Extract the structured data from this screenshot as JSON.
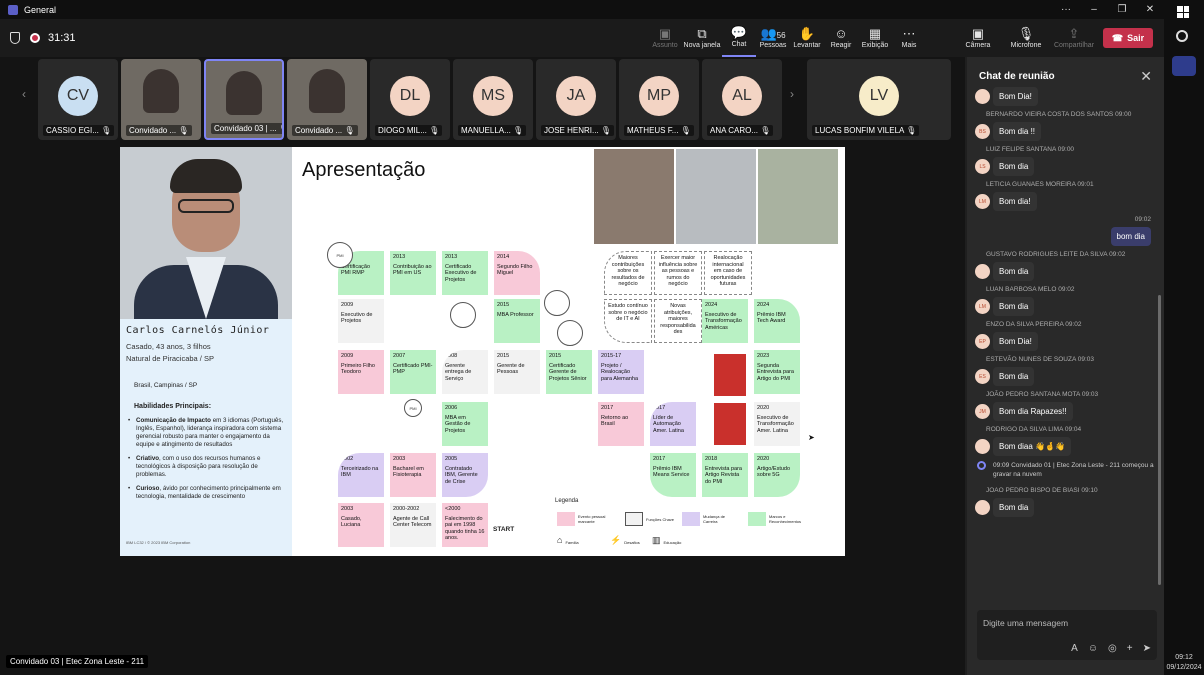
{
  "window": {
    "title": "General"
  },
  "meeting": {
    "timer": "31:31"
  },
  "toolbar": {
    "items": [
      {
        "label": "Assunto",
        "icon": "camera-off"
      },
      {
        "label": "Nova janela",
        "icon": "pop-out"
      },
      {
        "label": "Chat",
        "icon": "chat"
      },
      {
        "label": "Pessoas",
        "icon": "people",
        "count": "56"
      },
      {
        "label": "Levantar",
        "icon": "hand"
      },
      {
        "label": "Reagir",
        "icon": "smile"
      },
      {
        "label": "Exibição",
        "icon": "grid"
      },
      {
        "label": "Mais",
        "icon": "more"
      },
      {
        "label": "Câmera",
        "icon": "camera-off"
      },
      {
        "label": "Microfone",
        "icon": "mic-off"
      },
      {
        "label": "Compartilhar",
        "icon": "share"
      }
    ],
    "leave_label": "Sair"
  },
  "participants": [
    {
      "initials": "CV",
      "name": "CASSIO EGI...",
      "color": "#c9dff2",
      "video": false
    },
    {
      "initials": "",
      "name": "Convidado ...",
      "video": true
    },
    {
      "initials": "",
      "name": "Convidado 03 | ...",
      "video": true
    },
    {
      "initials": "",
      "name": "Convidado ...",
      "video": true
    },
    {
      "initials": "DL",
      "name": "DIOGO MIL...",
      "color": "#f3d4c4",
      "video": false
    },
    {
      "initials": "MS",
      "name": "MANUELLA...",
      "color": "#f3d4c4",
      "video": false
    },
    {
      "initials": "JA",
      "name": "JOSE HENRI...",
      "color": "#f3d4c4",
      "video": false
    },
    {
      "initials": "MP",
      "name": "MATHEUS F...",
      "color": "#f3d4c4",
      "video": false
    },
    {
      "initials": "AL",
      "name": "ANA CARO...",
      "color": "#f3d4c4",
      "video": false
    },
    {
      "initials": "LV",
      "name": "LUCAS BONFIM VILELA",
      "color": "#f7ecc9",
      "video": false
    }
  ],
  "slide": {
    "title": "Apresentação",
    "name": "Carlos Carnelós Júnior",
    "age_line": "Casado, 43 anos, 3 filhos",
    "origin_line": "Natural de Piracicaba / SP",
    "location": "Brasil, Campinas / SP",
    "skills_title": "Habilidades Principais:",
    "skills": [
      {
        "bold": "Comunicação de Impacto",
        "text": " em 3 idiomas (Português, Inglês, Espanhol), liderança inspiradora com sistema gerencial robusto para manter o engajamento da equipe e atingimento de resultados"
      },
      {
        "bold": "Criativo",
        "text": ", com o uso dos recursos humanos e tecnológicos à disposição para resolução de problemas."
      },
      {
        "bold": "Curioso",
        "text": ", ávido por conhecimento principalmente em tecnologia, mentalidade de crescimento"
      }
    ],
    "copyright": "IBM LC32 / © 2023 IBM Corporation",
    "timeline": [
      {
        "year": "2011",
        "text": "Certificação PMI RMP"
      },
      {
        "year": "2013",
        "text": "Contribuição ao PMI em US"
      },
      {
        "year": "2013",
        "text": "Certificado Executivo de Projetos"
      },
      {
        "year": "2014",
        "text": "Segundo Filho Miguel"
      },
      {
        "year": "2009",
        "text": "Executivo de Projetos"
      },
      {
        "year": "2015",
        "text": "MBA Professor"
      },
      {
        "year": "2009",
        "text": "Primeiro Filho Teodoro"
      },
      {
        "year": "2007",
        "text": "Certificado PMI-PMP"
      },
      {
        "year": "2008",
        "text": "Gerente entrega de Serviço"
      },
      {
        "year": "2015",
        "text": "Gerente de Pessoas"
      },
      {
        "year": "2015",
        "text": "Certificado Gerente de Projetos Sênior"
      },
      {
        "year": "2015-17",
        "text": "Projeto / Realocação para Alemanha"
      },
      {
        "year": "2006",
        "text": "MBA em Gestão de Projetos"
      },
      {
        "year": "2017",
        "text": "Retorno ao Brasil"
      },
      {
        "year": "2017",
        "text": "Líder de Automação Amer. Latina"
      },
      {
        "year": "2002",
        "text": "Terceirizado na IBM"
      },
      {
        "year": "2003",
        "text": "Bacharel em Fisioterapia"
      },
      {
        "year": "2005",
        "text": "Contratado IBM, Gerente de Crise"
      },
      {
        "year": "2017",
        "text": "Prêmio IBM Means Service"
      },
      {
        "year": "2018",
        "text": "Entrevista para Artigo Revista do PMI"
      },
      {
        "year": "2020",
        "text": "Artigo/Estudo sobre 5G"
      },
      {
        "year": "2003",
        "text": "Casado, Luciana"
      },
      {
        "year": "2000-2002",
        "text": "Agente de Call Center Telecom"
      },
      {
        "year": "<2000",
        "text": "Falecimento do pai em 1998 quando tinha 16 anos."
      },
      {
        "year": "2024",
        "text": "Executivo de Transformação Américas"
      },
      {
        "year": "2024",
        "text": "Prêmio IBM Tech Award"
      },
      {
        "year": "2023",
        "text": "Segunda Entrevista para Artigo do PMI"
      },
      {
        "year": "2020",
        "text": "Executivo de Transformação Amer. Latina"
      }
    ],
    "future_boxes": [
      "Maiores contribuições sobre os resultados de negócio",
      "Exercer maior influência sobre as pessoas e rumos do negócio",
      "Realocação internacional em caso de oportunidades futuras",
      "Estudo contínuo sobre o negócio de IT e AI",
      "Novas atribuições, maiores responsabilida des"
    ],
    "start_label": "START",
    "legend_title": "Legenda",
    "legend": [
      {
        "label": "Evento pessoal marcante",
        "color": "#f8c9d8"
      },
      {
        "label": "Funções Chave",
        "color": "#f2f2f2"
      },
      {
        "label": "Mudança de Carreira",
        "color": "#d9cdf3"
      },
      {
        "label": "Marcos e Reconhecimentos",
        "color": "#b9f1c4"
      },
      {
        "label": "Família",
        "icon": "house"
      },
      {
        "label": "Desafios",
        "icon": "lightning"
      },
      {
        "label": "Educação",
        "icon": "books"
      }
    ]
  },
  "presenter_caption": "Convidado 03 | Etec Zona Leste - 211",
  "chat": {
    "title": "Chat de reunião",
    "messages": [
      {
        "type": "msg",
        "sender": "",
        "time": "",
        "initials": "",
        "text": "Bom Dia!"
      },
      {
        "type": "msg",
        "sender": "BERNARDO VIEIRA COSTA DOS SANTOS",
        "time": "09:00",
        "initials": "BS",
        "text": "Bom dia !!"
      },
      {
        "type": "msg",
        "sender": "LUIZ FELIPE SANTANA",
        "time": "09:00",
        "initials": "LS",
        "text": "Bom dia"
      },
      {
        "type": "msg",
        "sender": "LETICIA GUANAES MOREIRA",
        "time": "09:01",
        "initials": "LM",
        "text": "Bom dia!"
      },
      {
        "type": "mine",
        "time": "09:02",
        "text": "bom dia"
      },
      {
        "type": "msg",
        "sender": "GUSTAVO RODRIGUES LEITE DA SILVA",
        "time": "09:02",
        "initials": "",
        "text": "Bom dia"
      },
      {
        "type": "msg",
        "sender": "LUAN BARBOSA MELO",
        "time": "09:02",
        "initials": "LM",
        "text": "Bom dia"
      },
      {
        "type": "msg",
        "sender": "ENZO DA SILVA PEREIRA",
        "time": "09:02",
        "initials": "EP",
        "text": "Bom Dia!"
      },
      {
        "type": "msg",
        "sender": "ESTEVÃO NUNES DE SOUZA",
        "time": "09:03",
        "initials": "ES",
        "text": "Bom dia"
      },
      {
        "type": "msg",
        "sender": "JOÃO PEDRO SANTANA MOTA",
        "time": "09:03",
        "initials": "JM",
        "text": "Bom dia Rapazes!!"
      },
      {
        "type": "msg",
        "sender": "RODRIGO DA SILVA LIMA",
        "time": "09:04",
        "initials": "",
        "text": "Bom diaa 👋🤞👋"
      },
      {
        "type": "sys",
        "time": "09:09",
        "text": "Convidado 01 | Etec Zona Leste - 211 começou a gravar na nuvem"
      },
      {
        "type": "msg",
        "sender": "JOAO PEDRO BISPO DE BIASI",
        "time": "09:10",
        "initials": "",
        "text": "Bom dia"
      }
    ],
    "compose_placeholder": "Digite uma mensagem"
  },
  "taskbar": {
    "time": "09:12",
    "date": "09/12/2024"
  }
}
